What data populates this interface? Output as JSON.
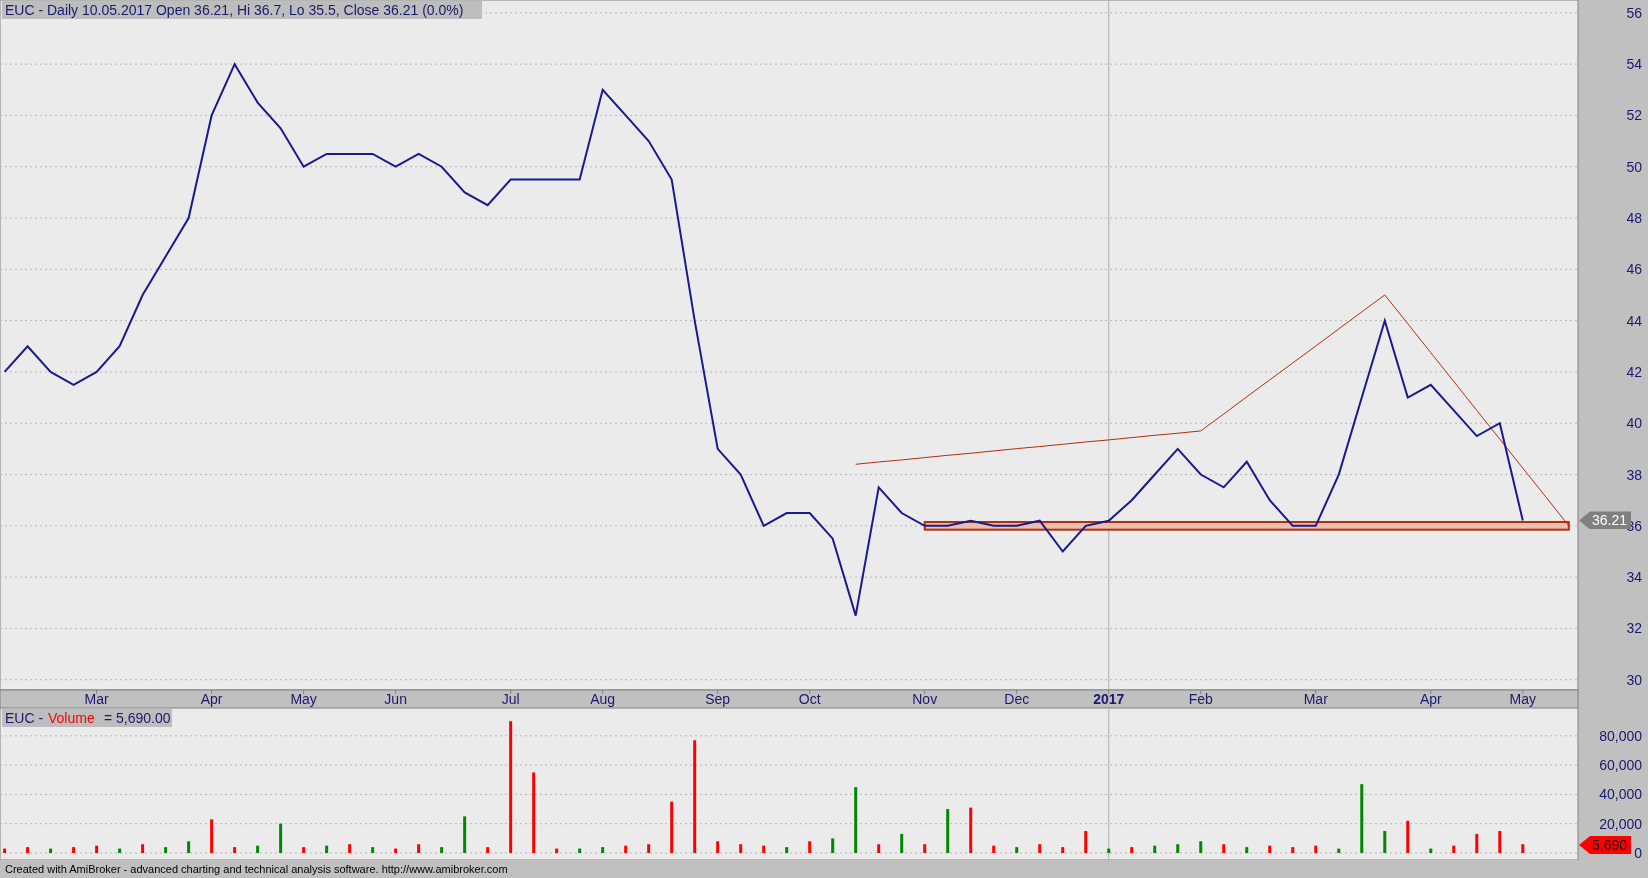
{
  "price_pane": {
    "last_price": "36.21",
    "axis_label_is_year": [
      false,
      false,
      false,
      false,
      false,
      false,
      false,
      false,
      false,
      false,
      true,
      false,
      false,
      false,
      false
    ],
    "chart_data": {
      "type": "line",
      "title": "EUC - Daily 10.05.2017 Open 36.21, Hi 36.7, Lo 35.5, Close 36.21 (0.0%)",
      "categories": [
        null,
        null,
        null,
        null,
        "Mar",
        null,
        null,
        null,
        null,
        "Apr",
        null,
        null,
        null,
        "May",
        null,
        null,
        null,
        "Jun",
        null,
        null,
        null,
        null,
        "Jul",
        null,
        null,
        null,
        "Aug",
        null,
        null,
        null,
        null,
        "Sep",
        null,
        null,
        null,
        "Oct",
        null,
        null,
        null,
        null,
        "Nov",
        null,
        null,
        null,
        "Dec",
        null,
        null,
        null,
        "2017",
        null,
        null,
        null,
        "Feb",
        null,
        null,
        null,
        null,
        "Mar",
        null,
        null,
        null,
        null,
        "Apr",
        null,
        null,
        null,
        "May",
        null,
        null
      ],
      "series": [
        {
          "color": "#1a1a8c",
          "values": [
            42,
            43,
            42,
            41.5,
            42,
            43,
            45,
            46.5,
            48,
            52,
            54,
            52.5,
            51.5,
            50,
            50.5,
            50.5,
            50.5,
            50,
            50.5,
            50,
            49,
            48.5,
            49.5,
            49.5,
            49.5,
            49.5,
            53,
            52,
            51,
            49.5,
            44,
            39,
            38,
            36,
            36.5,
            36.5,
            35.5,
            32.5,
            37.5,
            36.5,
            36,
            36,
            36.2,
            36,
            36,
            36.2,
            35,
            36,
            36.2,
            37,
            38,
            39,
            38,
            37.5,
            38.5,
            37,
            36,
            36,
            38,
            41,
            44,
            41,
            41.5,
            40.5,
            39.5,
            40,
            36.21,
            null,
            null
          ]
        },
        {
          "color": "#b03010",
          "values": [
            null,
            null,
            null,
            null,
            null,
            null,
            null,
            null,
            null,
            null,
            null,
            null,
            null,
            null,
            null,
            null,
            null,
            null,
            null,
            null,
            null,
            null,
            null,
            null,
            null,
            null,
            null,
            null,
            null,
            null,
            null,
            null,
            null,
            null,
            null,
            null,
            null,
            38.4,
            38.49,
            38.57,
            38.66,
            38.75,
            38.83,
            38.92,
            39.01,
            39.09,
            39.18,
            39.27,
            39.35,
            39.44,
            39.53,
            39.61,
            39.7,
            40.36,
            41.03,
            41.69,
            42.35,
            43.01,
            43.68,
            44.34,
            45,
            43.88,
            42.75,
            41.63,
            40.5,
            39.38,
            38.25,
            37.13,
            36
          ]
        }
      ],
      "ylim": [
        29.6,
        56.5
      ],
      "grid": true,
      "yticks": [
        30,
        32,
        34,
        36,
        38,
        40,
        42,
        44,
        46,
        48,
        50,
        52,
        54,
        56
      ]
    }
  },
  "volume_pane": {
    "legend": {
      "symbol": "EUC -",
      "indicator": "Volume",
      "value": "= 5,690.00"
    },
    "last_volume": "5,690",
    "chart_data": {
      "type": "bar",
      "stacked": true,
      "grid": true,
      "categories": [
        null,
        null,
        null,
        null,
        null,
        null,
        null,
        null,
        null,
        null,
        null,
        null,
        null,
        null,
        null,
        null,
        null,
        null,
        null,
        null,
        null,
        null,
        null,
        null,
        null,
        null,
        null,
        null,
        null,
        null,
        null,
        null,
        null,
        null,
        null,
        null,
        null,
        null,
        null,
        null,
        null,
        null,
        null,
        null,
        null,
        null,
        null,
        null,
        null,
        null,
        null,
        null,
        null,
        null,
        null,
        null,
        null,
        null,
        null,
        null,
        null,
        null,
        null,
        null,
        null,
        null,
        null
      ],
      "series": [
        {
          "color": "#008800",
          "values": [
            null,
            null,
            3000,
            null,
            null,
            3000,
            null,
            4000,
            8000,
            null,
            null,
            5000,
            20000,
            null,
            5000,
            null,
            4000,
            null,
            null,
            4000,
            25000,
            null,
            null,
            null,
            null,
            3000,
            4000,
            null,
            null,
            null,
            null,
            null,
            null,
            null,
            4000,
            null,
            10000,
            45000,
            null,
            13000,
            null,
            30000,
            null,
            null,
            4000,
            null,
            null,
            null,
            3000,
            null,
            5000,
            6000,
            8000,
            null,
            4000,
            null,
            null,
            null,
            3000,
            47000,
            15000,
            null,
            3000,
            null,
            null,
            null,
            null
          ]
        },
        {
          "color": "#ff0000",
          "values": [
            3000,
            4000,
            null,
            4000,
            5000,
            null,
            6000,
            null,
            null,
            23000,
            4000,
            null,
            null,
            4000,
            null,
            6000,
            null,
            3000,
            6000,
            null,
            null,
            4000,
            90000,
            55000,
            3000,
            null,
            null,
            5000,
            6000,
            35000,
            77000,
            8000,
            6000,
            5000,
            null,
            8000,
            null,
            null,
            6000,
            null,
            6000,
            null,
            31000,
            5000,
            null,
            6000,
            4000,
            15000,
            null,
            4000,
            null,
            null,
            null,
            6000,
            null,
            5000,
            4000,
            5000,
            null,
            null,
            null,
            22000,
            null,
            5000,
            13000,
            15000,
            6000
          ]
        }
      ],
      "ylim": [
        0,
        99000
      ],
      "yticks": [
        {
          "value": 0,
          "label": "0"
        },
        {
          "value": 20000,
          "label": "20,000"
        },
        {
          "value": 40000,
          "label": "40,000"
        },
        {
          "value": 60000,
          "label": "60,000"
        },
        {
          "value": 80000,
          "label": "80,000"
        }
      ]
    }
  },
  "status_bar": "Created with AmiBroker - advanced charting and technical analysis software. http://www.amibroker.com"
}
